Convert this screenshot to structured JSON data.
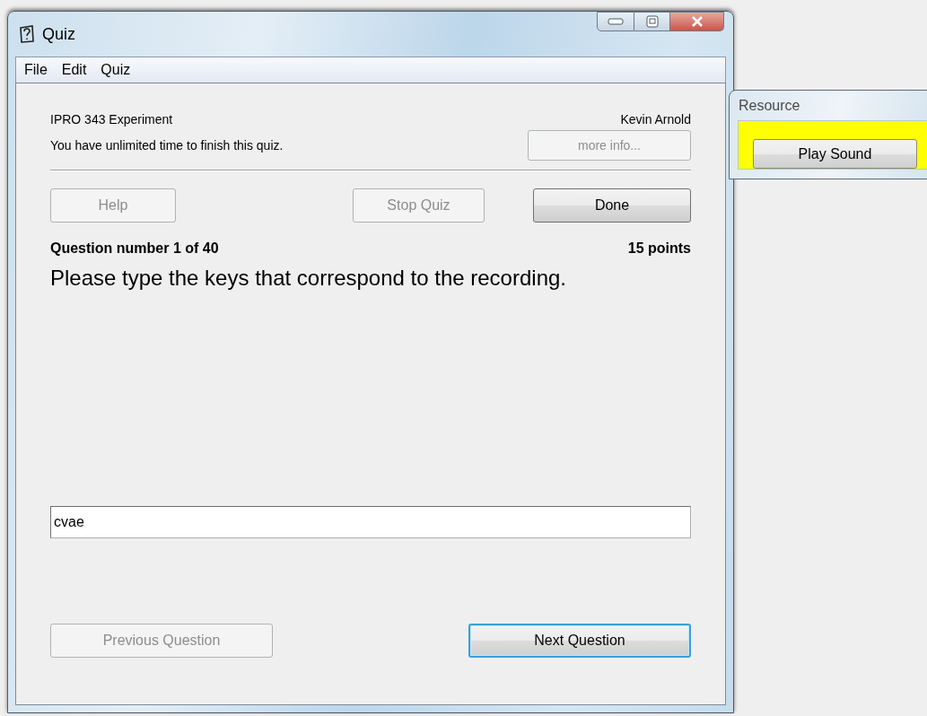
{
  "quiz_window": {
    "title": "Quiz",
    "menu": [
      "File",
      "Edit",
      "Quiz"
    ],
    "course": "IPRO 343 Experiment",
    "student": "Kevin Arnold",
    "time_note": "You have unlimited time to finish this quiz.",
    "more_info_button": {
      "label": "more info...",
      "disabled": true
    },
    "toolbar_buttons": [
      {
        "label": "Help",
        "disabled": true
      },
      {
        "label": "Stop Quiz",
        "disabled": true
      },
      {
        "label": "Done",
        "disabled": false
      }
    ],
    "question_number": "Question number 1 of 40",
    "points": "15 points",
    "prompt": "Please type the keys that correspond to the recording.",
    "answer": {
      "value": "cvae"
    },
    "nav_buttons": [
      {
        "label": "Previous Question",
        "disabled": true,
        "focused": false
      },
      {
        "label": "Next Question",
        "disabled": false,
        "focused": true
      }
    ]
  },
  "resource_window": {
    "title": "Resource",
    "highlighted": true,
    "button": {
      "label": "Play Sound"
    }
  }
}
